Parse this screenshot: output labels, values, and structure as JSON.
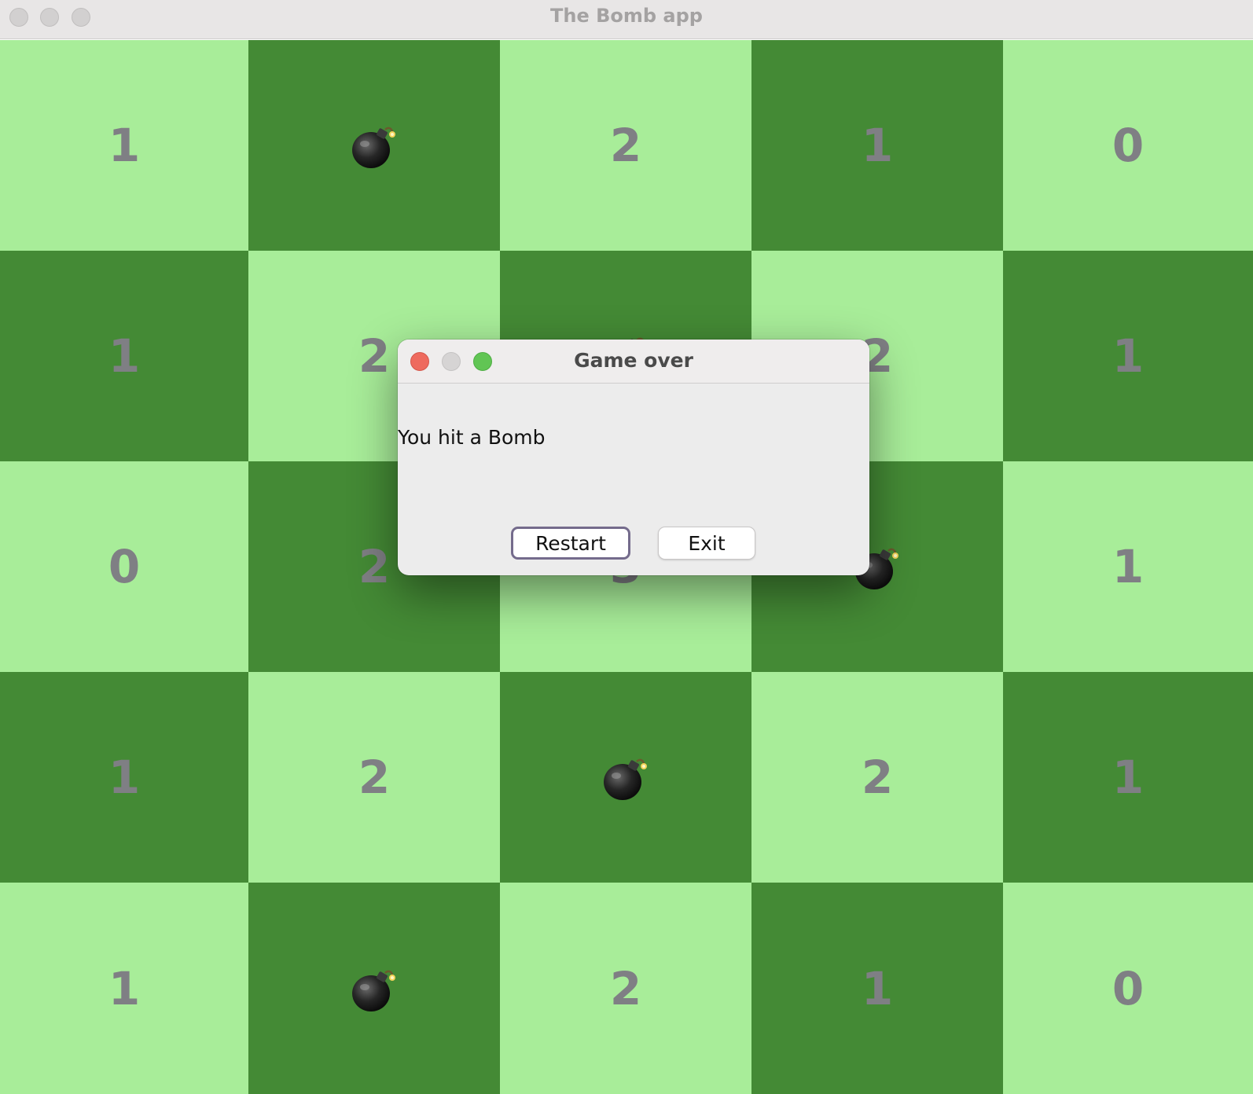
{
  "window": {
    "title": "The Bomb app"
  },
  "board": {
    "colors": {
      "light": "#a8ed99",
      "dark": "#448a35",
      "number": "#7f7f84"
    },
    "rows": [
      [
        {
          "value": "1",
          "bomb": false
        },
        {
          "value": "",
          "bomb": true
        },
        {
          "value": "2",
          "bomb": false
        },
        {
          "value": "1",
          "bomb": false
        },
        {
          "value": "0",
          "bomb": false
        }
      ],
      [
        {
          "value": "1",
          "bomb": false
        },
        {
          "value": "2",
          "bomb": false
        },
        {
          "value": "",
          "bomb": true
        },
        {
          "value": "2",
          "bomb": false
        },
        {
          "value": "1",
          "bomb": false
        }
      ],
      [
        {
          "value": "0",
          "bomb": false
        },
        {
          "value": "2",
          "bomb": false
        },
        {
          "value": "3",
          "bomb": false
        },
        {
          "value": "",
          "bomb": true
        },
        {
          "value": "1",
          "bomb": false
        }
      ],
      [
        {
          "value": "1",
          "bomb": false
        },
        {
          "value": "2",
          "bomb": false
        },
        {
          "value": "",
          "bomb": true
        },
        {
          "value": "2",
          "bomb": false
        },
        {
          "value": "1",
          "bomb": false
        }
      ],
      [
        {
          "value": "1",
          "bomb": false
        },
        {
          "value": "",
          "bomb": true
        },
        {
          "value": "2",
          "bomb": false
        },
        {
          "value": "1",
          "bomb": false
        },
        {
          "value": "0",
          "bomb": false
        }
      ]
    ]
  },
  "dialog": {
    "title": "Game over",
    "message": "You hit a Bomb",
    "restart_label": "Restart",
    "exit_label": "Exit"
  }
}
